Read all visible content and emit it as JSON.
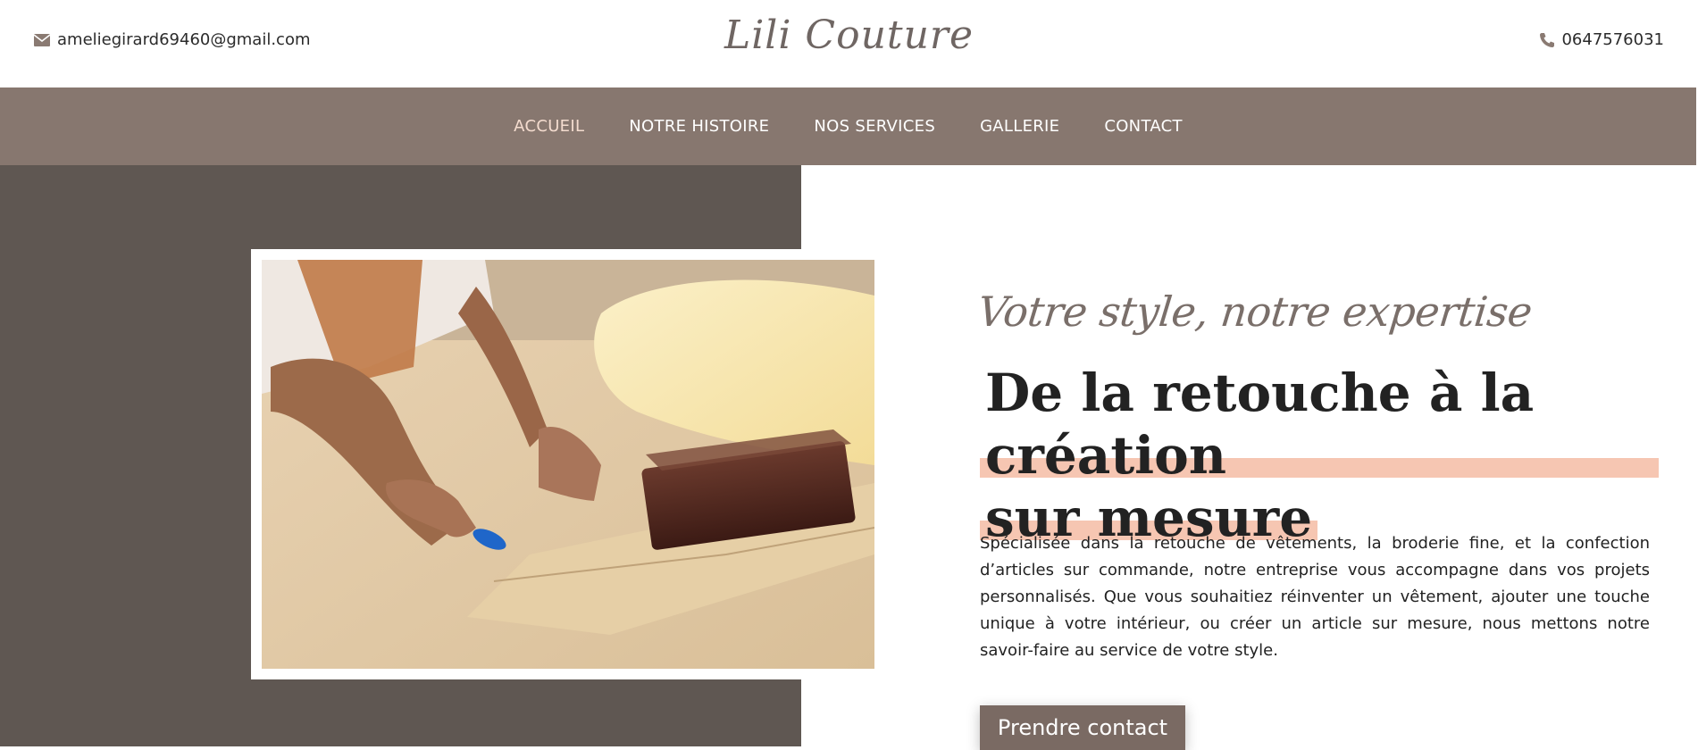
{
  "header": {
    "email": "ameliegirard69460@gmail.com",
    "logo": "Lili Couture",
    "phone": "0647576031",
    "email_icon": "envelope-icon",
    "phone_icon": "phone-icon"
  },
  "nav": {
    "items": [
      {
        "label": "ACCUEIL",
        "active": true
      },
      {
        "label": "NOTRE HISTOIRE",
        "active": false
      },
      {
        "label": "NOS SERVICES",
        "active": false
      },
      {
        "label": "GALLERIE",
        "active": false
      },
      {
        "label": "CONTACT",
        "active": false
      }
    ]
  },
  "hero": {
    "subtitle": "Votre style, notre expertise",
    "heading_line1": "De la retouche à la création",
    "heading_line2": "sur mesure",
    "description": "Spécialisée dans la retouche de vêtements, la broderie fine, et la confection d’articles sur commande, notre entreprise vous accompagne dans vos projets personnalisés. Que vous souhaitiez réinventer un vêtement, ajouter une touche unique à votre intérieur, ou créer un article sur mesure, nous mettons notre savoir-faire au service de votre style.",
    "cta_label": "Prendre contact"
  },
  "colors": {
    "nav_bg": "#87776f",
    "panel_bg": "#5f5752",
    "highlight": "#f6c6b2",
    "button_bg": "#7a6a63",
    "active_nav": "#f4dccf"
  }
}
